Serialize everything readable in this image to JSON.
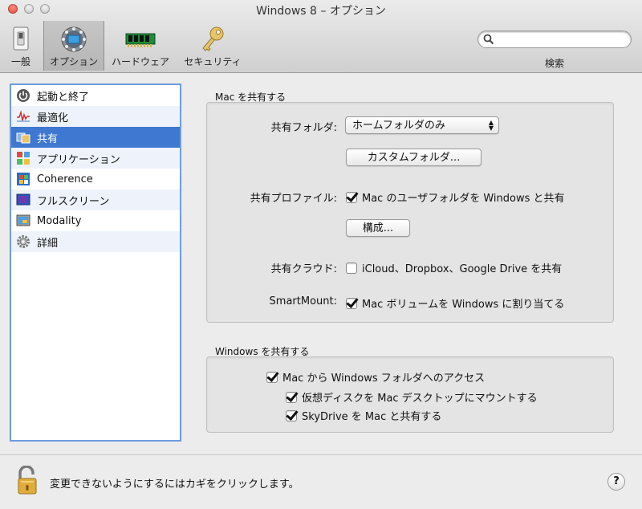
{
  "window": {
    "title": "Windows 8 – オプション"
  },
  "toolbar": {
    "items": [
      {
        "label": "一般",
        "icon": "switch-icon"
      },
      {
        "label": "オプション",
        "icon": "options-icon",
        "selected": true
      },
      {
        "label": "ハードウェア",
        "icon": "memory-chip-icon"
      },
      {
        "label": "セキュリティ",
        "icon": "key-icon"
      }
    ],
    "search": {
      "label": "検索",
      "placeholder": ""
    }
  },
  "sidebar": {
    "items": [
      {
        "label": "起動と終了",
        "icon": "power-icon"
      },
      {
        "label": "最適化",
        "icon": "activity-icon"
      },
      {
        "label": "共有",
        "icon": "folders-icon",
        "selected": true
      },
      {
        "label": "アプリケーション",
        "icon": "apps-icon"
      },
      {
        "label": "Coherence",
        "icon": "coherence-icon"
      },
      {
        "label": "フルスクリーン",
        "icon": "fullscreen-icon"
      },
      {
        "label": "Modality",
        "icon": "modality-icon"
      },
      {
        "label": "詳細",
        "icon": "gear-icon"
      }
    ]
  },
  "mac_share": {
    "title": "Mac を共有する",
    "shared_folders_label": "共有フォルダ:",
    "shared_folders_value": "ホームフォルダのみ",
    "custom_folder_button": "カスタムフォルダ...",
    "shared_profile_label": "共有プロファイル:",
    "shared_profile_checkbox": "Mac のユーザフォルダを Windows と共有",
    "shared_profile_checked": true,
    "configure_button": "構成...",
    "shared_cloud_label": "共有クラウド:",
    "shared_cloud_checkbox": "iCloud、Dropbox、Google Drive を共有",
    "shared_cloud_checked": false,
    "smartmount_label": "SmartMount:",
    "smartmount_checkbox": "Mac ボリュームを Windows に割り当てる",
    "smartmount_checked": true
  },
  "windows_share": {
    "title": "Windows を共有する",
    "access_checkbox": "Mac から Windows フォルダへのアクセス",
    "access_checked": true,
    "mount_checkbox": "仮想ディスクを Mac デスクトップにマウントする",
    "mount_checked": true,
    "skydrive_checkbox": "SkyDrive を Mac と共有する",
    "skydrive_checked": true
  },
  "footer": {
    "lock_text": "変更できないようにするにはカギをクリックします。",
    "help_label": "?"
  },
  "colors": {
    "selection": "#3f78d1",
    "sidebar_border": "#6f9be0"
  }
}
